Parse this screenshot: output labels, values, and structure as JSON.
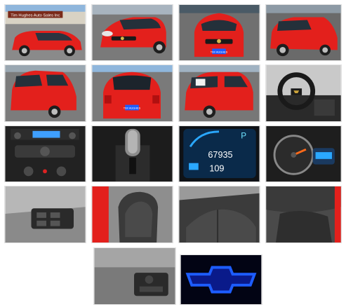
{
  "gallery": {
    "dealer_sign": "Tim Hughes Auto Sales Inc",
    "plate_text": "TIM HUGHES",
    "photos": [
      {
        "name": "front-left-exterior"
      },
      {
        "name": "front-three-quarter"
      },
      {
        "name": "front-view"
      },
      {
        "name": "front-right-exterior"
      },
      {
        "name": "rear-left-exterior"
      },
      {
        "name": "rear-view"
      },
      {
        "name": "rear-right-exterior"
      },
      {
        "name": "steering-wheel-interior"
      },
      {
        "name": "center-console-stereo"
      },
      {
        "name": "gear-shifter"
      },
      {
        "name": "digital-dash-display"
      },
      {
        "name": "instrument-cluster"
      },
      {
        "name": "door-window-switches"
      },
      {
        "name": "front-seats"
      },
      {
        "name": "rear-seats"
      },
      {
        "name": "rear-seat-floor"
      },
      {
        "name": "headlight-switch"
      },
      {
        "name": "lit-bowtie-emblem"
      }
    ]
  },
  "dash": {
    "odometer": "67935",
    "fuel_range": "109",
    "gear": "P"
  },
  "colors": {
    "car_red": "#e3201c",
    "sky": "#8fb6dc",
    "asphalt": "#6e6e6e",
    "interior_dark": "#2a2a2a",
    "dash_blue": "#2aa8ff",
    "emblem_blue": "#1d5dff"
  }
}
